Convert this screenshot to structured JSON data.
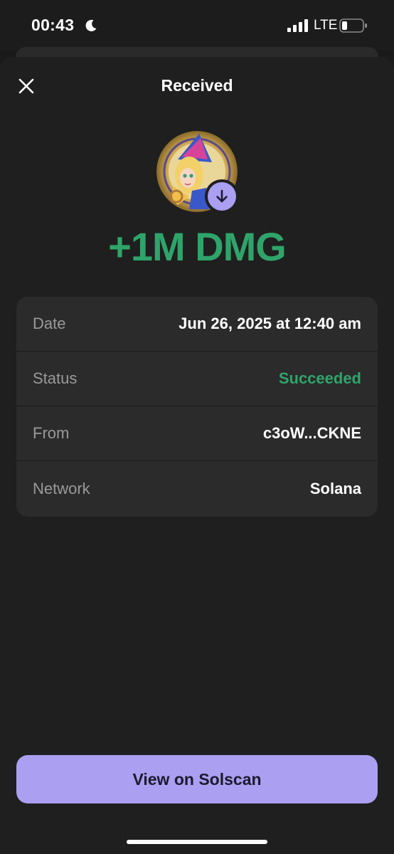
{
  "status_bar": {
    "time": "00:43",
    "network": "LTE"
  },
  "header": {
    "title": "Received"
  },
  "token": {
    "amount": "+1M DMG",
    "amount_color": "#2fa46a",
    "avatar": "token-avatar-image",
    "badge_icon": "arrow-down-icon"
  },
  "details": [
    {
      "label": "Date",
      "value": "Jun 26, 2025 at 12:40 am"
    },
    {
      "label": "Status",
      "value": "Succeeded"
    },
    {
      "label": "From",
      "value": "c3oW...CKNE"
    },
    {
      "label": "Network",
      "value": "Solana"
    }
  ],
  "action": {
    "solscan_label": "View on Solscan",
    "accent_color": "#ab9ff2"
  }
}
